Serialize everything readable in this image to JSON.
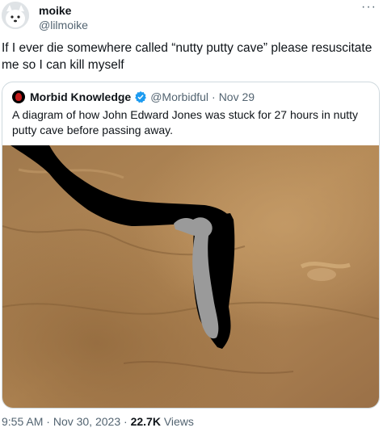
{
  "tweet": {
    "author_name": "moike",
    "author_handle": "@lilmoike",
    "more_icon": "···",
    "text": "If I ever die somewhere called “nutty putty cave” please resuscitate me so I can kill myself"
  },
  "quote": {
    "author_name": "Morbid Knowledge",
    "author_handle": "@Morbidful",
    "separator": "·",
    "date": "Nov 29",
    "text": "A diagram of how John Edward Jones was stuck for 27 hours in nutty putty cave before passing away.",
    "verified_color": "#1d9bf0"
  },
  "meta": {
    "time": "9:55 AM",
    "separator": " · ",
    "date": "Nov 30, 2023",
    "views_count": "22.7K",
    "views_label": " Views"
  }
}
